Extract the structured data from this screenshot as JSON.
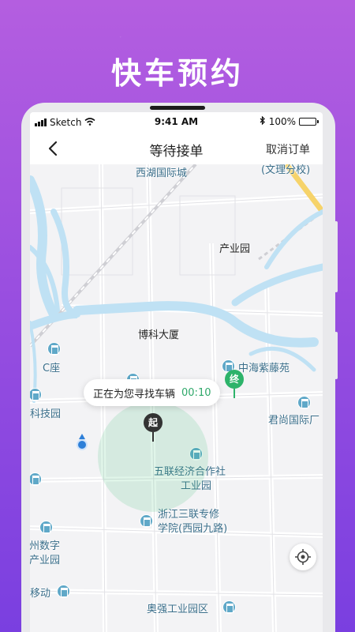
{
  "promo": {
    "title": "快车预约"
  },
  "status_bar": {
    "carrier": "Sketch",
    "time": "9:41 AM",
    "battery": "100%"
  },
  "nav": {
    "title": "等待接单",
    "action_label": "取消订单",
    "back_icon": "chevron-left-icon"
  },
  "map": {
    "labels": {
      "west_lake": "西湖国际城",
      "school": "(文理分校)",
      "industrial_park": "产业园",
      "boke": "博科大厦",
      "c_block": "C座",
      "zhonghai": "中海紫藤苑",
      "tech_park": "科技园",
      "junshang": "君尚国际厂",
      "wulian_1": "五联经济合作社",
      "wulian_2": "工业园",
      "sanlian_1": "浙江三联专修",
      "sanlian_2": "学院(西园九路)",
      "hz_digital_1": "杭州数字",
      "hz_digital_2": "息产业园",
      "mobile": "移动",
      "aoqiang": "奥强工业园区"
    },
    "tooltip": {
      "text": "正在为您寻找车辆",
      "timer": "00:10"
    },
    "start_pin": "起",
    "end_pin": "终",
    "colors": {
      "start": "#333333",
      "end": "#2db36a",
      "water": "#bfe1f4",
      "accent_timer": "#2fa86a"
    }
  }
}
